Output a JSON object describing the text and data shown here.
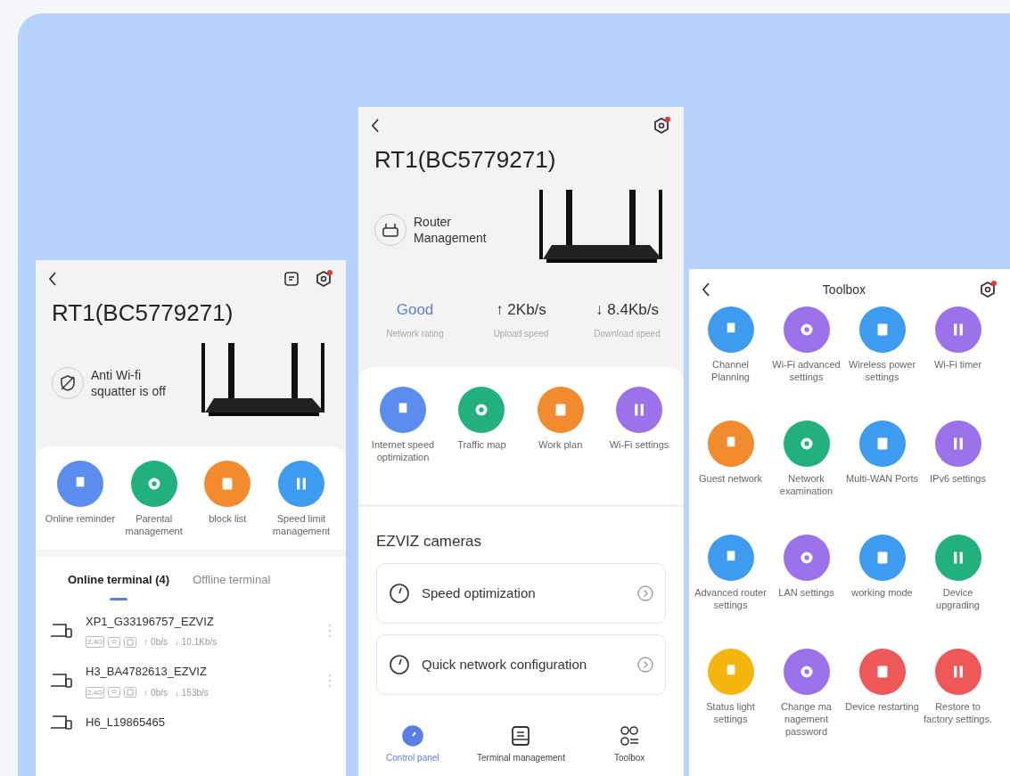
{
  "left_phone": {
    "title": "RT1(BC5779271)",
    "status_text": "Anti Wi-fi squatter is off",
    "shortcuts": [
      {
        "label": "Online reminder",
        "color": "#5b8def"
      },
      {
        "label": "Parental management",
        "color": "#22b07d"
      },
      {
        "label": "block list",
        "color": "#f28a2e"
      },
      {
        "label": "Speed limit management",
        "color": "#3d9cf0"
      }
    ],
    "tabs": [
      {
        "label": "Online terminal (4)",
        "selected": true
      },
      {
        "label": "Offline terminal",
        "selected": false
      }
    ],
    "terminals": [
      {
        "name": "XP1_G33196757_EZVIZ",
        "band": "2.4G",
        "upload": "↑ 0b/s",
        "download": "↓ 10.1Kb/s"
      },
      {
        "name": "H3_BA4782613_EZVIZ",
        "band": "2.4G",
        "upload": "↑ 0b/s",
        "download": "↓ 153b/s"
      },
      {
        "name": "H6_L19865465"
      }
    ]
  },
  "middle_phone": {
    "title": "RT1(BC5779271)",
    "status_text": "Router Management",
    "stats": [
      {
        "value": "Good",
        "label": "Network rating",
        "kind": "rating"
      },
      {
        "value": "↑ 2Kb/s",
        "label": "Upload speed",
        "kind": "speed"
      },
      {
        "value": "↓ 8.4Kb/s",
        "label": "Download speed",
        "kind": "speed"
      }
    ],
    "shortcuts": [
      {
        "label": "Internet speed optimization",
        "color": "#5b8def"
      },
      {
        "label": "Traffic map",
        "color": "#22b07d"
      },
      {
        "label": "Work plan",
        "color": "#f28a2e"
      },
      {
        "label": "Wi-Fi settings",
        "color": "#9b72ea"
      }
    ],
    "section_title": "EZVIZ cameras",
    "camera_actions": [
      "Speed optimization",
      "Quick network configuration"
    ],
    "nav": [
      {
        "label": "Control panel",
        "selected": true
      },
      {
        "label": "Terminal management",
        "selected": false
      },
      {
        "label": "Toolbox",
        "selected": false
      }
    ]
  },
  "right_phone": {
    "title": "Toolbox",
    "tools": [
      {
        "label": "Channel Planning",
        "color": "#3d9cf0"
      },
      {
        "label": "Wi-Fi advanced settings",
        "color": "#9b72ea"
      },
      {
        "label": "Wireless power settings",
        "color": "#3d9cf0"
      },
      {
        "label": "Wi-Fi timer",
        "color": "#9b72ea"
      },
      {
        "label": "Guest network",
        "color": "#f28a2e"
      },
      {
        "label": "Network examination",
        "color": "#22b07d"
      },
      {
        "label": "Multi-WAN Ports",
        "color": "#3d9cf0"
      },
      {
        "label": "IPv6 settings",
        "color": "#9b72ea"
      },
      {
        "label": "Advanced router settings",
        "color": "#3d9cf0"
      },
      {
        "label": "LAN settings",
        "color": "#9b72ea"
      },
      {
        "label": "working mode",
        "color": "#3d9cf0"
      },
      {
        "label": "Device upgrading",
        "color": "#22b07d"
      },
      {
        "label": "Status light settings",
        "color": "#f5b50f"
      },
      {
        "label": "Change ma nagement password",
        "color": "#9b72ea"
      },
      {
        "label": "Device restarting",
        "color": "#ef5858"
      },
      {
        "label": "Restore to factory settings.",
        "color": "#ef5858"
      }
    ]
  }
}
